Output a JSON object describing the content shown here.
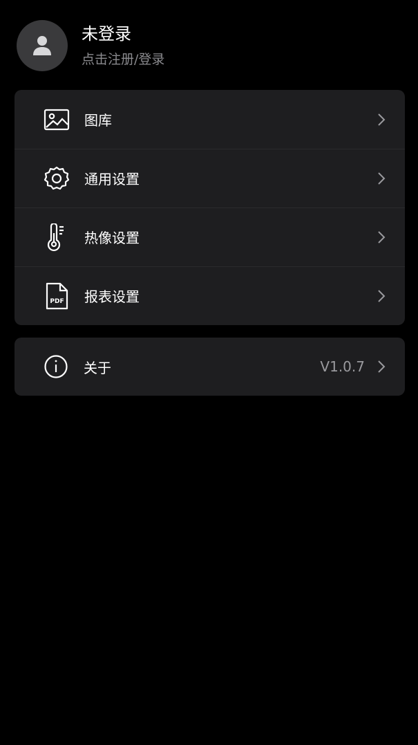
{
  "profile": {
    "name": "未登录",
    "subtitle": "点击注册/登录"
  },
  "menu": {
    "items": [
      {
        "label": "图库",
        "icon": "gallery-icon"
      },
      {
        "label": "通用设置",
        "icon": "gear-icon"
      },
      {
        "label": "热像设置",
        "icon": "thermometer-icon"
      },
      {
        "label": "报表设置",
        "icon": "pdf-file-icon"
      }
    ]
  },
  "about": {
    "label": "关于",
    "icon": "info-icon",
    "version": "V1.0.7"
  },
  "colors": {
    "background": "#000000",
    "card": "#1e1e20",
    "secondary_text": "#8a8a8e",
    "avatar_bg": "#3a3a3c"
  }
}
